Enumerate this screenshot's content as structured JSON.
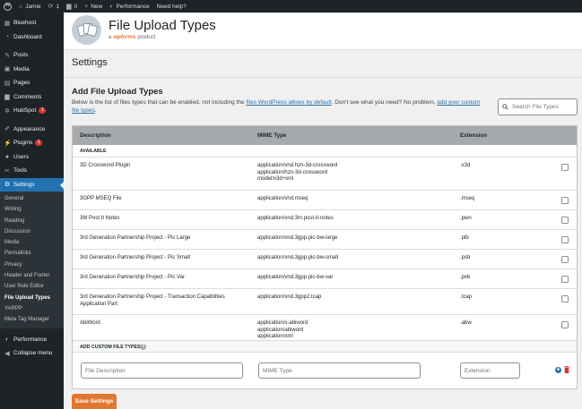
{
  "admin_bar": {
    "site_name": "Jamie",
    "updates_count": "1",
    "comments_count": "0",
    "new_label": "New",
    "performance_label": "Performance",
    "help_label": "Need help?"
  },
  "sidebar": {
    "items": [
      {
        "label": "Bluehost",
        "icon": "bluehost-icon"
      },
      {
        "label": "Dashboard",
        "icon": "dashboard-icon"
      },
      {
        "label": "Posts",
        "icon": "pin-icon"
      },
      {
        "label": "Media",
        "icon": "media-icon"
      },
      {
        "label": "Pages",
        "icon": "page-icon"
      },
      {
        "label": "Comments",
        "icon": "comment-icon"
      },
      {
        "label": "HubSpot",
        "icon": "hubspot-icon",
        "badge": "1"
      },
      {
        "label": "Appearance",
        "icon": "brush-icon"
      },
      {
        "label": "Plugins",
        "icon": "plugin-icon",
        "badge": "1"
      },
      {
        "label": "Users",
        "icon": "users-icon"
      },
      {
        "label": "Tools",
        "icon": "wrench-icon"
      },
      {
        "label": "Settings",
        "icon": "settings-icon"
      }
    ],
    "submenu": [
      "General",
      "Writing",
      "Reading",
      "Discussion",
      "Media",
      "Permalinks",
      "Privacy",
      "Header and Footer",
      "User Role Editor",
      "File Upload Types",
      "YARPP",
      "Meta Tag Manager"
    ],
    "bottom": [
      {
        "label": "Performance",
        "icon": "performance-icon"
      },
      {
        "label": "Collapse menu",
        "icon": "collapse-icon"
      }
    ]
  },
  "header": {
    "title": "File Upload Types",
    "sub_prefix": "a",
    "sub_brand": "wpforms",
    "sub_suffix": "product"
  },
  "page": {
    "title": "Settings",
    "section_title": "Add File Upload Types",
    "intro_1": "Below is the list of files types that can be enabled, not including the ",
    "intro_link_1": "files WordPress allows by default",
    "intro_2": ". Don't see what you need? No problem, ",
    "intro_link_2": "add your custom file types",
    "intro_3": ".",
    "search_placeholder": "Search File Types"
  },
  "table": {
    "headers": {
      "description": "Description",
      "mime": "MIME Type",
      "extension": "Extension"
    },
    "group_label": "AVAILABLE",
    "rows": [
      {
        "description": "3D Crossword Plugin",
        "mime": "application/vnd.hzn-3d-crossword\napplication/hzn-3d-crossword\nmodel/x3d+xml",
        "ext": ".x3d"
      },
      {
        "description": "3GPP MSEQ File",
        "mime": "application/vnd.mseq",
        "ext": ".mseq"
      },
      {
        "description": "3M Post It Notes",
        "mime": "application/vnd.3m.post-it-notes",
        "ext": ".pwn"
      },
      {
        "description": "3rd Generation Partnership Project - Pic Large",
        "mime": "application/vnd.3gpp.pic-bw-large",
        "ext": ".plb"
      },
      {
        "description": "3rd Generation Partnership Project - Pic Small",
        "mime": "application/vnd.3gpp.pic-bw-small",
        "ext": ".psb"
      },
      {
        "description": "3rd Generation Partnership Project - Pic Var",
        "mime": "application/vnd.3gpp.pic-bw-var",
        "ext": ".pvb"
      },
      {
        "description": "3rd Generation Partnership Project - Transaction Capabilities Application Part",
        "mime": "application/vnd.3gpp2.tcap",
        "ext": ".tcap"
      },
      {
        "description": "AbiWord",
        "mime": "application/x-abiword\napplication/abiword\napplication/xml",
        "ext": ".abw"
      }
    ],
    "custom_label": "ADD CUSTOM FILE TYPES",
    "custom_inputs": {
      "description_placeholder": "File Description",
      "mime_placeholder": "MIME Type",
      "ext_placeholder": "Extension"
    }
  },
  "save_label": "Save Settings",
  "colors": {
    "accent": "#2271b1",
    "brand_orange": "#e27730",
    "sidebar_bg": "#1d2327"
  }
}
